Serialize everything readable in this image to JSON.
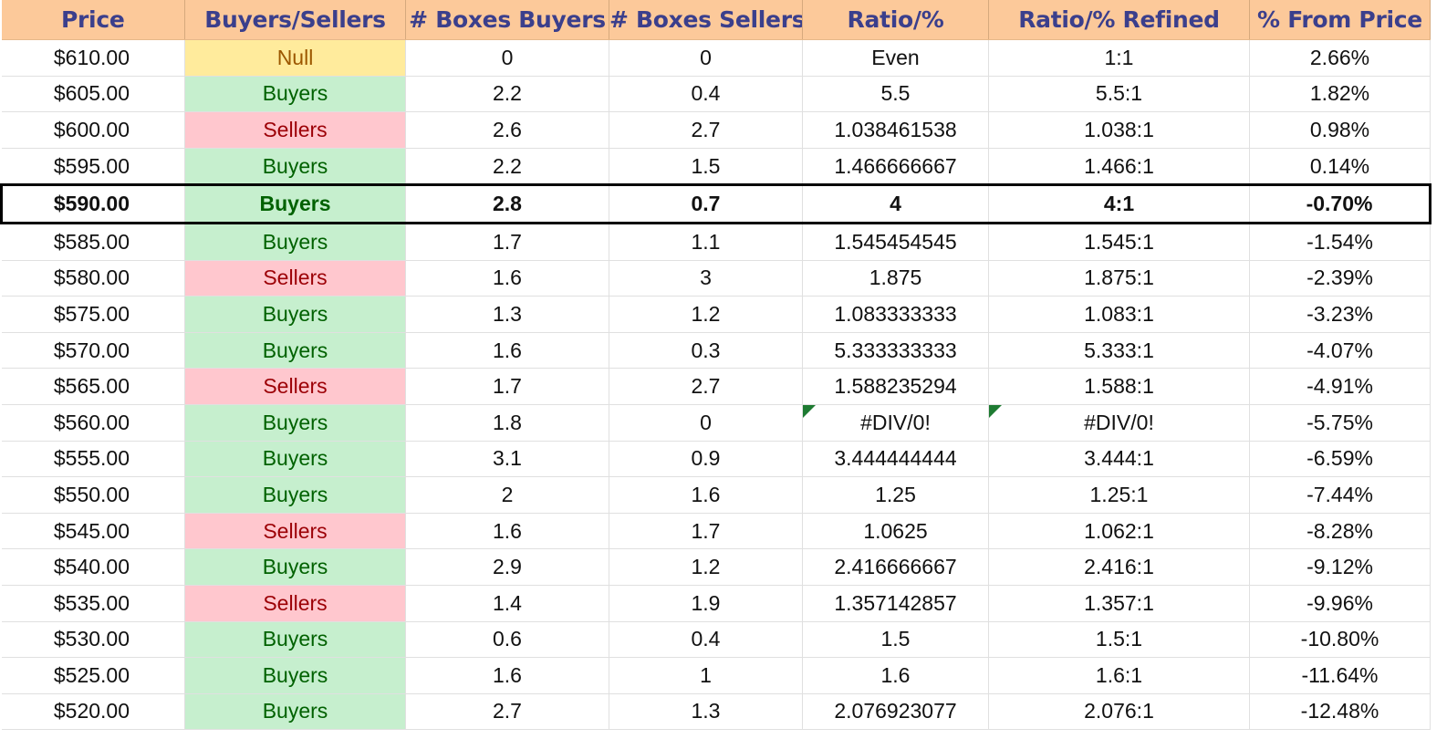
{
  "columns": [
    "Price",
    "Buyers/Sellers",
    "# Boxes Buyers",
    "# Boxes Sellers",
    "Ratio/%",
    "Ratio/% Refined",
    "% From Price"
  ],
  "current_price_row_index": 4,
  "colors": {
    "header_bg": "#fcc99a",
    "header_text": "#3b3f8c",
    "buyers_bg": "#c6efce",
    "buyers_text": "#006100",
    "sellers_bg": "#ffc7ce",
    "sellers_text": "#9c0006",
    "null_bg": "#ffeb9c",
    "null_text": "#9c5700",
    "error_flag": "#1e7b32"
  },
  "rows": [
    {
      "price": "$610.00",
      "side": "Null",
      "boxes_buyers": "0",
      "boxes_sellers": "0",
      "ratio": "Even",
      "ratio_refined": "1:1",
      "pct_from_price": "2.66%"
    },
    {
      "price": "$605.00",
      "side": "Buyers",
      "boxes_buyers": "2.2",
      "boxes_sellers": "0.4",
      "ratio": "5.5",
      "ratio_refined": "5.5:1",
      "pct_from_price": "1.82%"
    },
    {
      "price": "$600.00",
      "side": "Sellers",
      "boxes_buyers": "2.6",
      "boxes_sellers": "2.7",
      "ratio": "1.038461538",
      "ratio_refined": "1.038:1",
      "pct_from_price": "0.98%"
    },
    {
      "price": "$595.00",
      "side": "Buyers",
      "boxes_buyers": "2.2",
      "boxes_sellers": "1.5",
      "ratio": "1.466666667",
      "ratio_refined": "1.466:1",
      "pct_from_price": "0.14%"
    },
    {
      "price": "$590.00",
      "side": "Buyers",
      "boxes_buyers": "2.8",
      "boxes_sellers": "0.7",
      "ratio": "4",
      "ratio_refined": "4:1",
      "pct_from_price": "-0.70%"
    },
    {
      "price": "$585.00",
      "side": "Buyers",
      "boxes_buyers": "1.7",
      "boxes_sellers": "1.1",
      "ratio": "1.545454545",
      "ratio_refined": "1.545:1",
      "pct_from_price": "-1.54%"
    },
    {
      "price": "$580.00",
      "side": "Sellers",
      "boxes_buyers": "1.6",
      "boxes_sellers": "3",
      "ratio": "1.875",
      "ratio_refined": "1.875:1",
      "pct_from_price": "-2.39%"
    },
    {
      "price": "$575.00",
      "side": "Buyers",
      "boxes_buyers": "1.3",
      "boxes_sellers": "1.2",
      "ratio": "1.083333333",
      "ratio_refined": "1.083:1",
      "pct_from_price": "-3.23%"
    },
    {
      "price": "$570.00",
      "side": "Buyers",
      "boxes_buyers": "1.6",
      "boxes_sellers": "0.3",
      "ratio": "5.333333333",
      "ratio_refined": "5.333:1",
      "pct_from_price": "-4.07%"
    },
    {
      "price": "$565.00",
      "side": "Sellers",
      "boxes_buyers": "1.7",
      "boxes_sellers": "2.7",
      "ratio": "1.588235294",
      "ratio_refined": "1.588:1",
      "pct_from_price": "-4.91%"
    },
    {
      "price": "$560.00",
      "side": "Buyers",
      "boxes_buyers": "1.8",
      "boxes_sellers": "0",
      "ratio": "#DIV/0!",
      "ratio_refined": "#DIV/0!",
      "pct_from_price": "-5.75%",
      "error": true
    },
    {
      "price": "$555.00",
      "side": "Buyers",
      "boxes_buyers": "3.1",
      "boxes_sellers": "0.9",
      "ratio": "3.444444444",
      "ratio_refined": "3.444:1",
      "pct_from_price": "-6.59%"
    },
    {
      "price": "$550.00",
      "side": "Buyers",
      "boxes_buyers": "2",
      "boxes_sellers": "1.6",
      "ratio": "1.25",
      "ratio_refined": "1.25:1",
      "pct_from_price": "-7.44%"
    },
    {
      "price": "$545.00",
      "side": "Sellers",
      "boxes_buyers": "1.6",
      "boxes_sellers": "1.7",
      "ratio": "1.0625",
      "ratio_refined": "1.062:1",
      "pct_from_price": "-8.28%"
    },
    {
      "price": "$540.00",
      "side": "Buyers",
      "boxes_buyers": "2.9",
      "boxes_sellers": "1.2",
      "ratio": "2.416666667",
      "ratio_refined": "2.416:1",
      "pct_from_price": "-9.12%"
    },
    {
      "price": "$535.00",
      "side": "Sellers",
      "boxes_buyers": "1.4",
      "boxes_sellers": "1.9",
      "ratio": "1.357142857",
      "ratio_refined": "1.357:1",
      "pct_from_price": "-9.96%"
    },
    {
      "price": "$530.00",
      "side": "Buyers",
      "boxes_buyers": "0.6",
      "boxes_sellers": "0.4",
      "ratio": "1.5",
      "ratio_refined": "1.5:1",
      "pct_from_price": "-10.80%"
    },
    {
      "price": "$525.00",
      "side": "Buyers",
      "boxes_buyers": "1.6",
      "boxes_sellers": "1",
      "ratio": "1.6",
      "ratio_refined": "1.6:1",
      "pct_from_price": "-11.64%"
    },
    {
      "price": "$520.00",
      "side": "Buyers",
      "boxes_buyers": "2.7",
      "boxes_sellers": "1.3",
      "ratio": "2.076923077",
      "ratio_refined": "2.076:1",
      "pct_from_price": "-12.48%"
    }
  ]
}
